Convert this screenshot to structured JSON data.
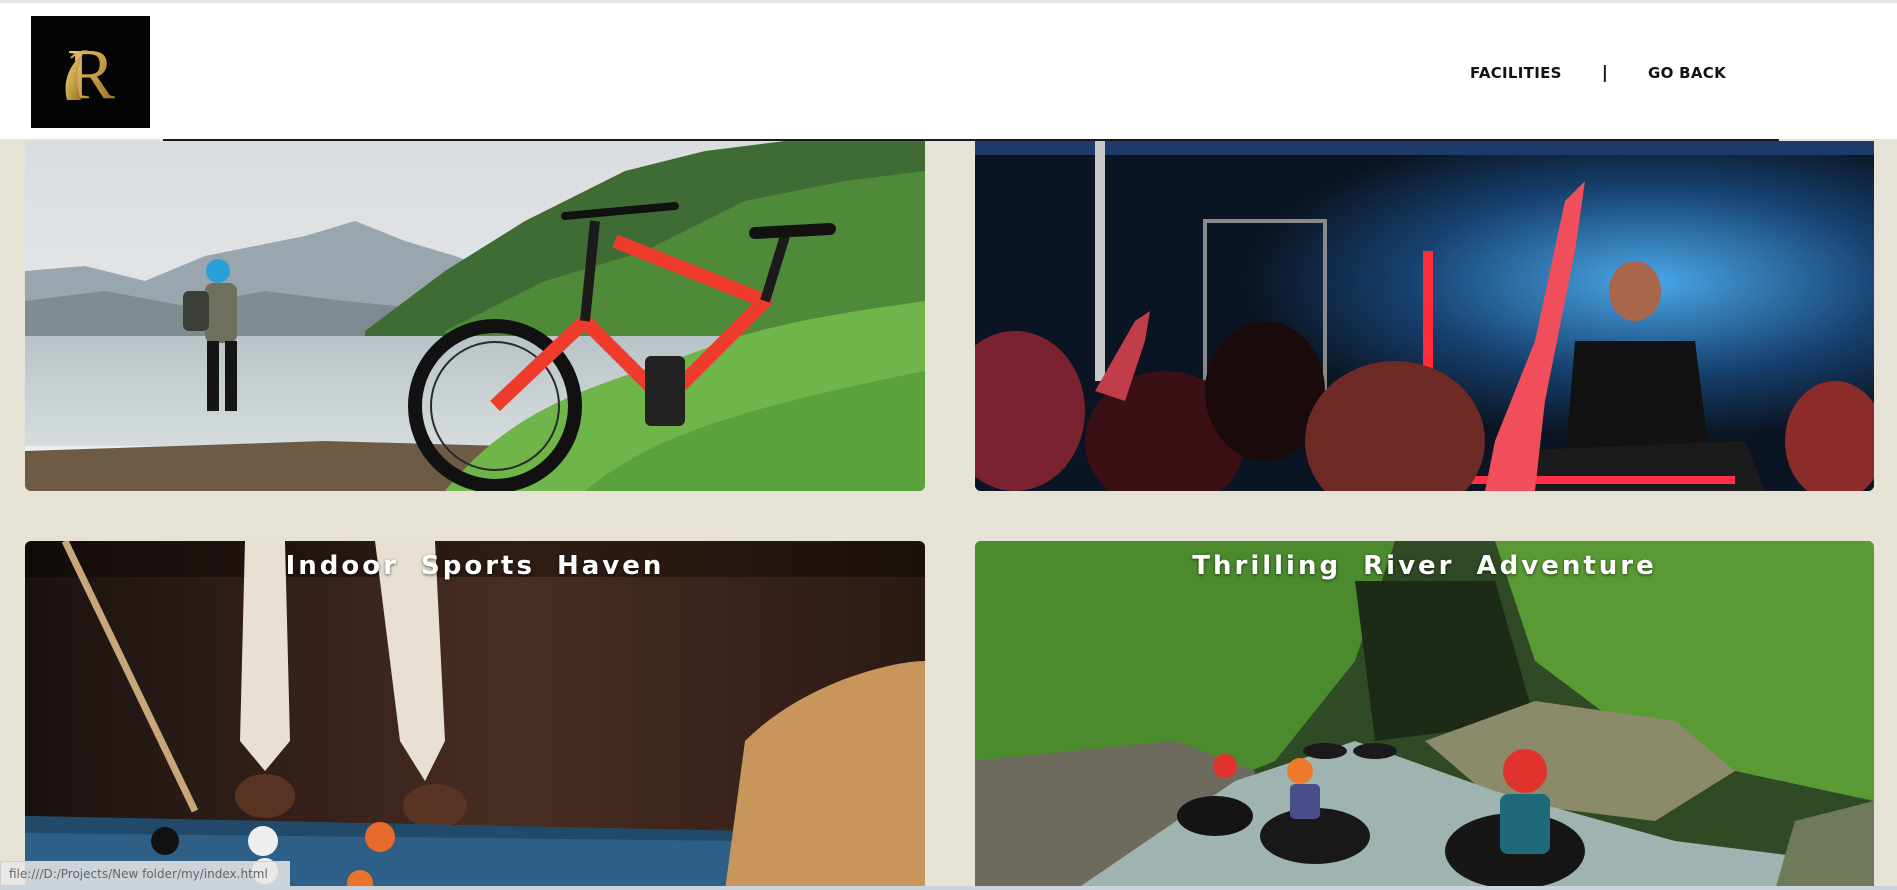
{
  "header": {
    "logo_letter": "R",
    "nav": {
      "facilities_label": "FACILITIES",
      "separator": "|",
      "go_back_label": "GO BACK"
    }
  },
  "cards": [
    {
      "title": "",
      "image": "mountain-bike-lake-photo"
    },
    {
      "title": "",
      "image": "nightclub-dj-party-photo"
    },
    {
      "title": "Indoor  Sports  Haven",
      "image": "billiards-table-photo"
    },
    {
      "title": "Thrilling  River  Adventure",
      "image": "river-tubing-photo"
    }
  ],
  "status_bar": {
    "url": "file:///D:/Projects/New folder/my/index.html"
  },
  "colors": {
    "page_bg": "#e6e2d6",
    "header_bg": "#ffffff",
    "logo_bg": "#050505",
    "logo_gold": "#c9a24a"
  }
}
